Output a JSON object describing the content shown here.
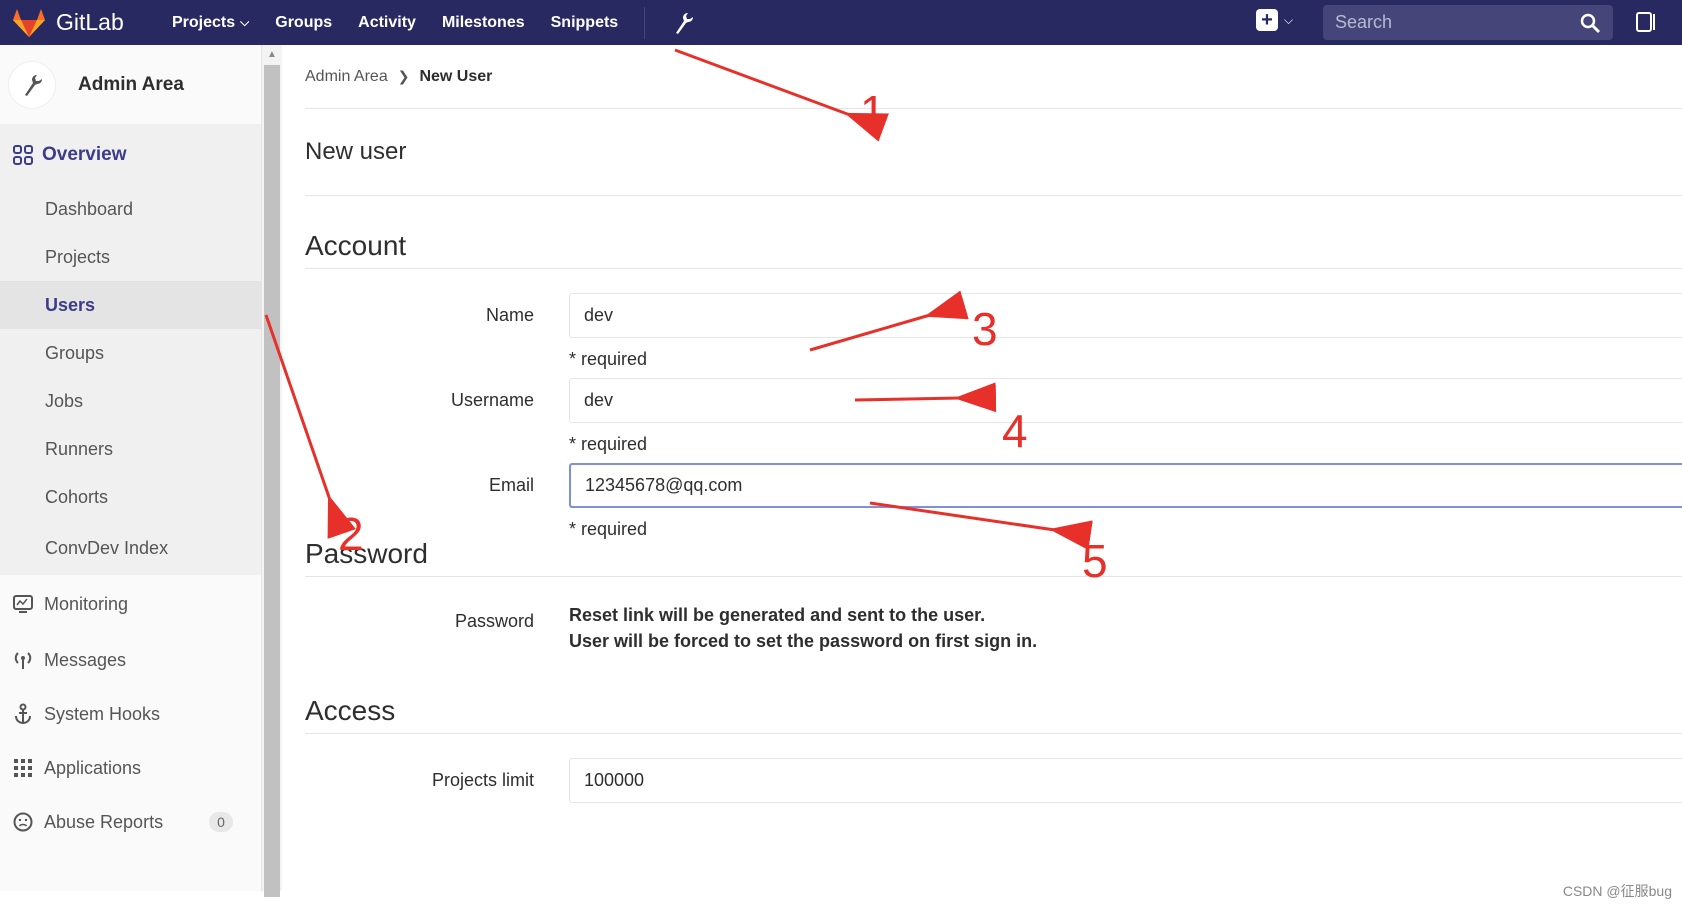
{
  "topbar": {
    "brand": "GitLab",
    "nav": [
      {
        "label": "Projects",
        "has_dropdown": true
      },
      {
        "label": "Groups"
      },
      {
        "label": "Activity"
      },
      {
        "label": "Milestones"
      },
      {
        "label": "Snippets"
      }
    ],
    "search_placeholder": "Search",
    "accent": "#292961"
  },
  "sidebar": {
    "title": "Admin Area",
    "overview_label": "Overview",
    "sub_items": [
      "Dashboard",
      "Projects",
      "Users",
      "Groups",
      "Jobs",
      "Runners",
      "Cohorts",
      "ConvDev Index"
    ],
    "active_sub": "Users",
    "items": [
      {
        "label": "Monitoring",
        "icon": "monitor-icon"
      },
      {
        "label": "Messages",
        "icon": "broadcast-icon"
      },
      {
        "label": "System Hooks",
        "icon": "anchor-icon"
      },
      {
        "label": "Applications",
        "icon": "grid-icon"
      },
      {
        "label": "Abuse Reports",
        "icon": "frown-icon",
        "count": "0"
      }
    ]
  },
  "breadcrumb": {
    "parent": "Admin Area",
    "current": "New User"
  },
  "page": {
    "title": "New user"
  },
  "account": {
    "section": "Account",
    "name": {
      "label": "Name",
      "value": "dev",
      "help": "* required"
    },
    "username": {
      "label": "Username",
      "value": "dev",
      "help": "* required"
    },
    "email": {
      "label": "Email",
      "value": "12345678@qq.com",
      "help": "* required"
    }
  },
  "password": {
    "section": "Password",
    "label": "Password",
    "line1": "Reset link will be generated and sent to the user.",
    "line2": "User will be forced to set the password on first sign in."
  },
  "access": {
    "section": "Access",
    "projects_limit_label": "Projects limit",
    "projects_limit_value": "100000"
  },
  "annotations": [
    "1",
    "2",
    "3",
    "4",
    "5"
  ],
  "watermark": "CSDN @征服bug"
}
